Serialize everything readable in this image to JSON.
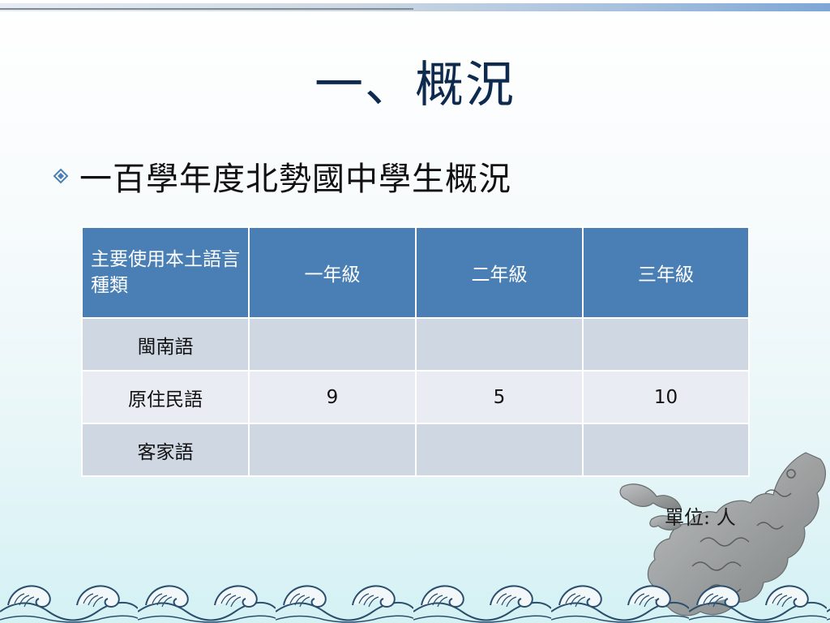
{
  "slide": {
    "title": "一、概況",
    "bullet_text": "一百學年度北勢國中學生概況",
    "unit_note": "單位: 人"
  },
  "table": {
    "headers": [
      "主要使用本土語言種類",
      "一年級",
      "二年級",
      "三年級"
    ],
    "rows": [
      {
        "language": "閩南語",
        "grade1": "",
        "grade2": "",
        "grade3": ""
      },
      {
        "language": "原住民語",
        "grade1": "9",
        "grade2": "5",
        "grade3": "10"
      },
      {
        "language": "客家語",
        "grade1": "",
        "grade2": "",
        "grade3": ""
      }
    ]
  },
  "decor": {
    "bullet_icon": "diamond-bullet-icon",
    "dragon_icon": "dragon-illustration",
    "waves_icon": "wave-pattern",
    "header_color": "#4a7fb5",
    "row_odd_color": "#cfd7e3",
    "row_even_color": "#e9ecf2",
    "title_color": "#0e2a4f"
  }
}
